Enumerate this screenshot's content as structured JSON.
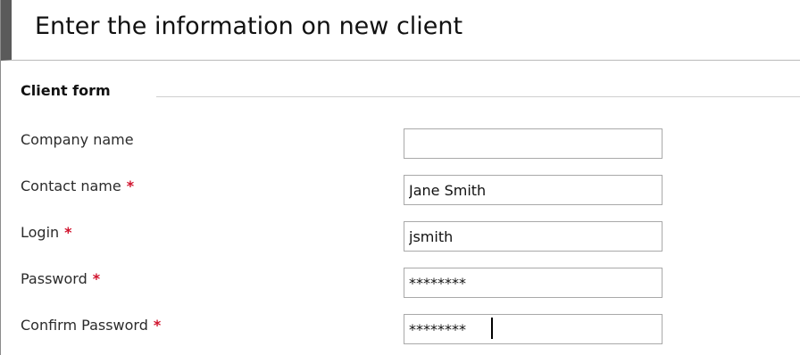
{
  "header": {
    "title": "Enter the information on new client"
  },
  "form": {
    "legend": "Client form",
    "required_marker": "*",
    "fields": [
      {
        "label": "Company name",
        "value": "",
        "required": false
      },
      {
        "label": "Contact name",
        "value": "Jane Smith",
        "required": true
      },
      {
        "label": "Login",
        "value": "jsmith",
        "required": true
      },
      {
        "label": "Password",
        "value": "********",
        "required": true
      },
      {
        "label": "Confirm Password",
        "value": "********",
        "required": true
      }
    ]
  },
  "colors": {
    "required_asterisk": "#d0112b",
    "title_accent_bar": "#5a5a5a",
    "field_border": "#a9a9a9"
  }
}
